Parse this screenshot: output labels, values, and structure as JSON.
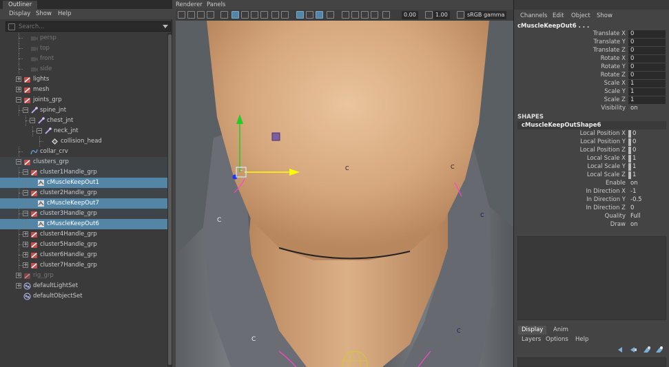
{
  "outliner": {
    "title": "Outliner",
    "menu": [
      "Display",
      "Show",
      "Help"
    ],
    "search_placeholder": "Search...",
    "items": [
      {
        "label": "persp",
        "icon": "camera-icon",
        "dim": true
      },
      {
        "label": "top",
        "icon": "camera-icon",
        "dim": true
      },
      {
        "label": "front",
        "icon": "camera-icon",
        "dim": true
      },
      {
        "label": "side",
        "icon": "camera-icon",
        "dim": true
      },
      {
        "label": "lights",
        "icon": "group-icon"
      },
      {
        "label": "mesh",
        "icon": "group-icon"
      },
      {
        "label": "joints_grp",
        "icon": "group-icon"
      },
      {
        "label": "spine_jnt",
        "icon": "joint-icon"
      },
      {
        "label": "chest_jnt",
        "icon": "joint-icon"
      },
      {
        "label": "neck_jnt",
        "icon": "joint-icon"
      },
      {
        "label": "collision_head",
        "icon": "locator-icon"
      },
      {
        "label": "collar_crv",
        "icon": "curve-icon"
      },
      {
        "label": "clusters_grp",
        "icon": "group-icon"
      },
      {
        "label": "cluster1Handle_grp",
        "icon": "group-icon"
      },
      {
        "label": "cMuscleKeepOut1",
        "icon": "muscle-icon"
      },
      {
        "label": "cluster2Handle_grp",
        "icon": "group-icon"
      },
      {
        "label": "cMuscleKeepOut7",
        "icon": "muscle-icon"
      },
      {
        "label": "cluster3Handle_grp",
        "icon": "group-icon"
      },
      {
        "label": "cMuscleKeepOut6",
        "icon": "muscle-icon"
      },
      {
        "label": "cluster4Handle_grp",
        "icon": "group-icon"
      },
      {
        "label": "cluster5Handle_grp",
        "icon": "group-icon"
      },
      {
        "label": "cluster6Handle_grp",
        "icon": "group-icon"
      },
      {
        "label": "cluster7Handle_grp",
        "icon": "group-icon"
      },
      {
        "label": "rig_grp",
        "icon": "group-icon",
        "dim": true
      },
      {
        "label": "defaultLightSet",
        "icon": "set-icon"
      },
      {
        "label": "defaultObjectSet",
        "icon": "set-icon"
      }
    ]
  },
  "viewport": {
    "menu": [
      "Renderer",
      "Panels"
    ],
    "exposure": "0.00",
    "gamma_value": "1.00",
    "color_space": "sRGB gamma",
    "cluster_marker": "C"
  },
  "channel_box": {
    "menu": [
      "Channels",
      "Edit",
      "Object",
      "Show"
    ],
    "object_name": "cMuscleKeepOut6 . . .",
    "attributes": [
      {
        "name": "Translate X",
        "value": "0"
      },
      {
        "name": "Translate Y",
        "value": "0"
      },
      {
        "name": "Translate Z",
        "value": "0"
      },
      {
        "name": "Rotate X",
        "value": "0"
      },
      {
        "name": "Rotate Y",
        "value": "0"
      },
      {
        "name": "Rotate Z",
        "value": "0"
      },
      {
        "name": "Scale X",
        "value": "1"
      },
      {
        "name": "Scale Y",
        "value": "1"
      },
      {
        "name": "Scale Z",
        "value": "1"
      },
      {
        "name": "Visibility",
        "value": "on"
      }
    ],
    "shapes_heading": "SHAPES",
    "shape_name": "cMuscleKeepOutShape6",
    "shape_attributes": [
      {
        "name": "Local Position X",
        "value": "0",
        "swatch": true
      },
      {
        "name": "Local Position Y",
        "value": "0",
        "swatch": true
      },
      {
        "name": "Local Position Z",
        "value": "0",
        "swatch": true
      },
      {
        "name": "Local Scale X",
        "value": "1",
        "swatch": true
      },
      {
        "name": "Local Scale Y",
        "value": "1",
        "swatch": true
      },
      {
        "name": "Local Scale Z",
        "value": "1",
        "swatch": true
      },
      {
        "name": "Enable",
        "value": "on"
      },
      {
        "name": "In Direction X",
        "value": "-1"
      },
      {
        "name": "In Direction Y",
        "value": "-0.5"
      },
      {
        "name": "In Direction Z",
        "value": "0"
      },
      {
        "name": "Quality",
        "value": "Full"
      },
      {
        "name": "Draw",
        "value": "on"
      }
    ]
  },
  "layer_editor": {
    "tabs": [
      "Display",
      "Anim"
    ],
    "menu": [
      "Layers",
      "Options",
      "Help"
    ]
  },
  "colors": {
    "selection": "#5285a6",
    "skin": "#d9ad84",
    "shirt": "#6a6e74",
    "axis_y": "#22cc22",
    "axis_x": "#ffff00",
    "axis_z": "#2233ff"
  }
}
